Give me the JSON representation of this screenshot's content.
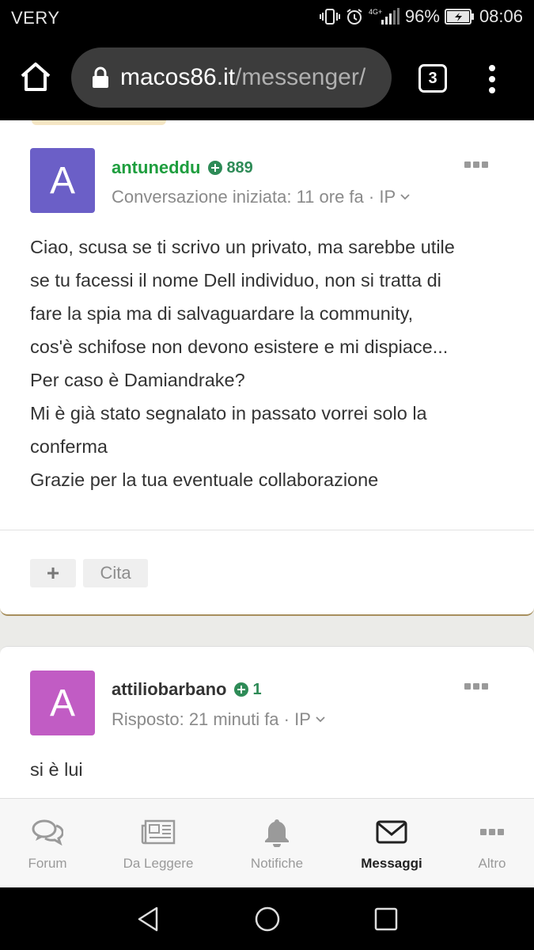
{
  "status_bar": {
    "carrier": "VERY",
    "network": "4G+",
    "battery": "96%",
    "time": "08:06"
  },
  "browser": {
    "url_host": "macos86.it",
    "url_path": "/messenger/",
    "tab_count": "3"
  },
  "messages": [
    {
      "avatar_letter": "A",
      "avatar_color": "#6b5fc7",
      "username": "antuneddu",
      "username_color": "#1e9e3e",
      "reputation": "889",
      "meta": "Conversazione iniziata: 11 ore fa · IP",
      "body": [
        "Ciao, scusa se ti scrivo un privato, ma sarebbe utile",
        "se tu facessi il nome Dell individuo, non si tratta di",
        "fare la spia ma di salvaguardare la community,",
        "cos'è schifose non devono esistere e mi dispiace...",
        "Per caso è Damiandrake?",
        "Mi è già stato segnalato in passato vorrei solo la",
        "conferma",
        "Grazie per la tua eventuale collaborazione"
      ],
      "actions": {
        "plus": "+",
        "quote": "Cita"
      }
    },
    {
      "avatar_letter": "A",
      "avatar_color": "#c15cc4",
      "username": "attiliobarbano",
      "username_color": "#333333",
      "reputation": "1",
      "meta": "Risposto: 21 minuti fa · IP",
      "body": [
        "si è lui"
      ]
    }
  ],
  "bottom_nav": {
    "items": [
      {
        "label": "Forum",
        "icon": "chat-bubbles-icon"
      },
      {
        "label": "Da Leggere",
        "icon": "newspaper-icon"
      },
      {
        "label": "Notifiche",
        "icon": "bell-icon"
      },
      {
        "label": "Messaggi",
        "icon": "envelope-icon",
        "active": true
      },
      {
        "label": "Altro",
        "icon": "more-dots-icon"
      }
    ]
  }
}
